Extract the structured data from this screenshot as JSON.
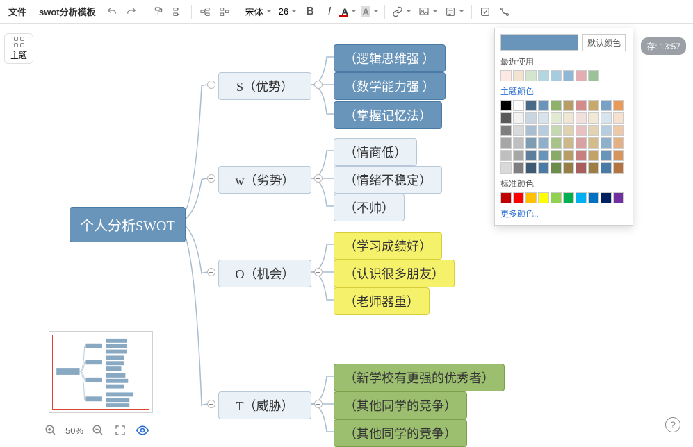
{
  "toolbar": {
    "file_label": "文件",
    "doc_title": "swot分析模板",
    "font_name": "宋体",
    "font_size": "26",
    "bold": "B",
    "italic": "I"
  },
  "theme_button": "主题",
  "save_badge": "存: 13:57",
  "zoom": {
    "level": "50%"
  },
  "color_panel": {
    "default_btn": "默认颜色",
    "recent": "最近使用",
    "theme": "主题颜色",
    "standard": "标准颜色",
    "more": "更多颜色..",
    "recent_colors": [
      "#fde8e3",
      "#f2e4cf",
      "#d3e4cf",
      "#b3d7e0",
      "#a7cce0",
      "#8fb8d6",
      "#e2aeb1",
      "#9cc29a"
    ],
    "theme_rows": [
      [
        "#000000",
        "#ffffff",
        "#4a6a8a",
        "#6a95bb",
        "#8fb26b",
        "#b79d66",
        "#d48b8b",
        "#c9a86b",
        "#7aa0c4",
        "#e79a5a"
      ],
      [
        "#595959",
        "#f2f2f2",
        "#c9d6e2",
        "#d7e4ee",
        "#e0ead2",
        "#efe7d4",
        "#f3dede",
        "#f1e8d5",
        "#d7e4ee",
        "#f6e1cf"
      ],
      [
        "#7f7f7f",
        "#d9d9d9",
        "#a9bfd1",
        "#b5cddf",
        "#c5d8af",
        "#e0d2b0",
        "#e8c2c2",
        "#e4d3b0",
        "#b5cddf",
        "#eec9a8"
      ],
      [
        "#a6a6a6",
        "#bfbfbf",
        "#7f9cb5",
        "#8fb0cb",
        "#a7c38a",
        "#cdb88a",
        "#d9a2a2",
        "#d4bc8a",
        "#8fb0cb",
        "#e3b184"
      ],
      [
        "#bfbfbf",
        "#a6a6a6",
        "#5c7d9b",
        "#6a95bb",
        "#89aa68",
        "#b79d66",
        "#c68080",
        "#c2a268",
        "#6a95bb",
        "#d6945f"
      ],
      [
        "#d9d9d9",
        "#7f7f7f",
        "#3e5a74",
        "#4b7aa5",
        "#6b8c4a",
        "#967d46",
        "#a85e5e",
        "#9d7f46",
        "#4b7aa5",
        "#b5733f"
      ]
    ],
    "standard_colors": [
      "#c00000",
      "#ff0000",
      "#ffc000",
      "#ffff00",
      "#92d050",
      "#00b050",
      "#00b0f0",
      "#0070c0",
      "#002060",
      "#7030a0"
    ]
  },
  "mindmap": {
    "root": "个人分析SWOT",
    "branches": [
      {
        "key": "S",
        "label": "S（优势）",
        "items": [
          "（逻辑思维强 ）",
          "（数学能力强 ）",
          "（掌握记忆法）"
        ]
      },
      {
        "key": "W",
        "label": "w（劣势）",
        "items": [
          "（情商低）",
          "（情绪不稳定）",
          "（不帅）"
        ]
      },
      {
        "key": "O",
        "label": "O（机会）",
        "items": [
          "（学习成绩好）",
          "（认识很多朋友）",
          "（老师器重）"
        ]
      },
      {
        "key": "T",
        "label": "T（威胁）",
        "items": [
          "（新学校有更强的优秀者）",
          "（其他同学的竞争）",
          "（其他同学的竞争）"
        ]
      }
    ]
  },
  "help": "?"
}
